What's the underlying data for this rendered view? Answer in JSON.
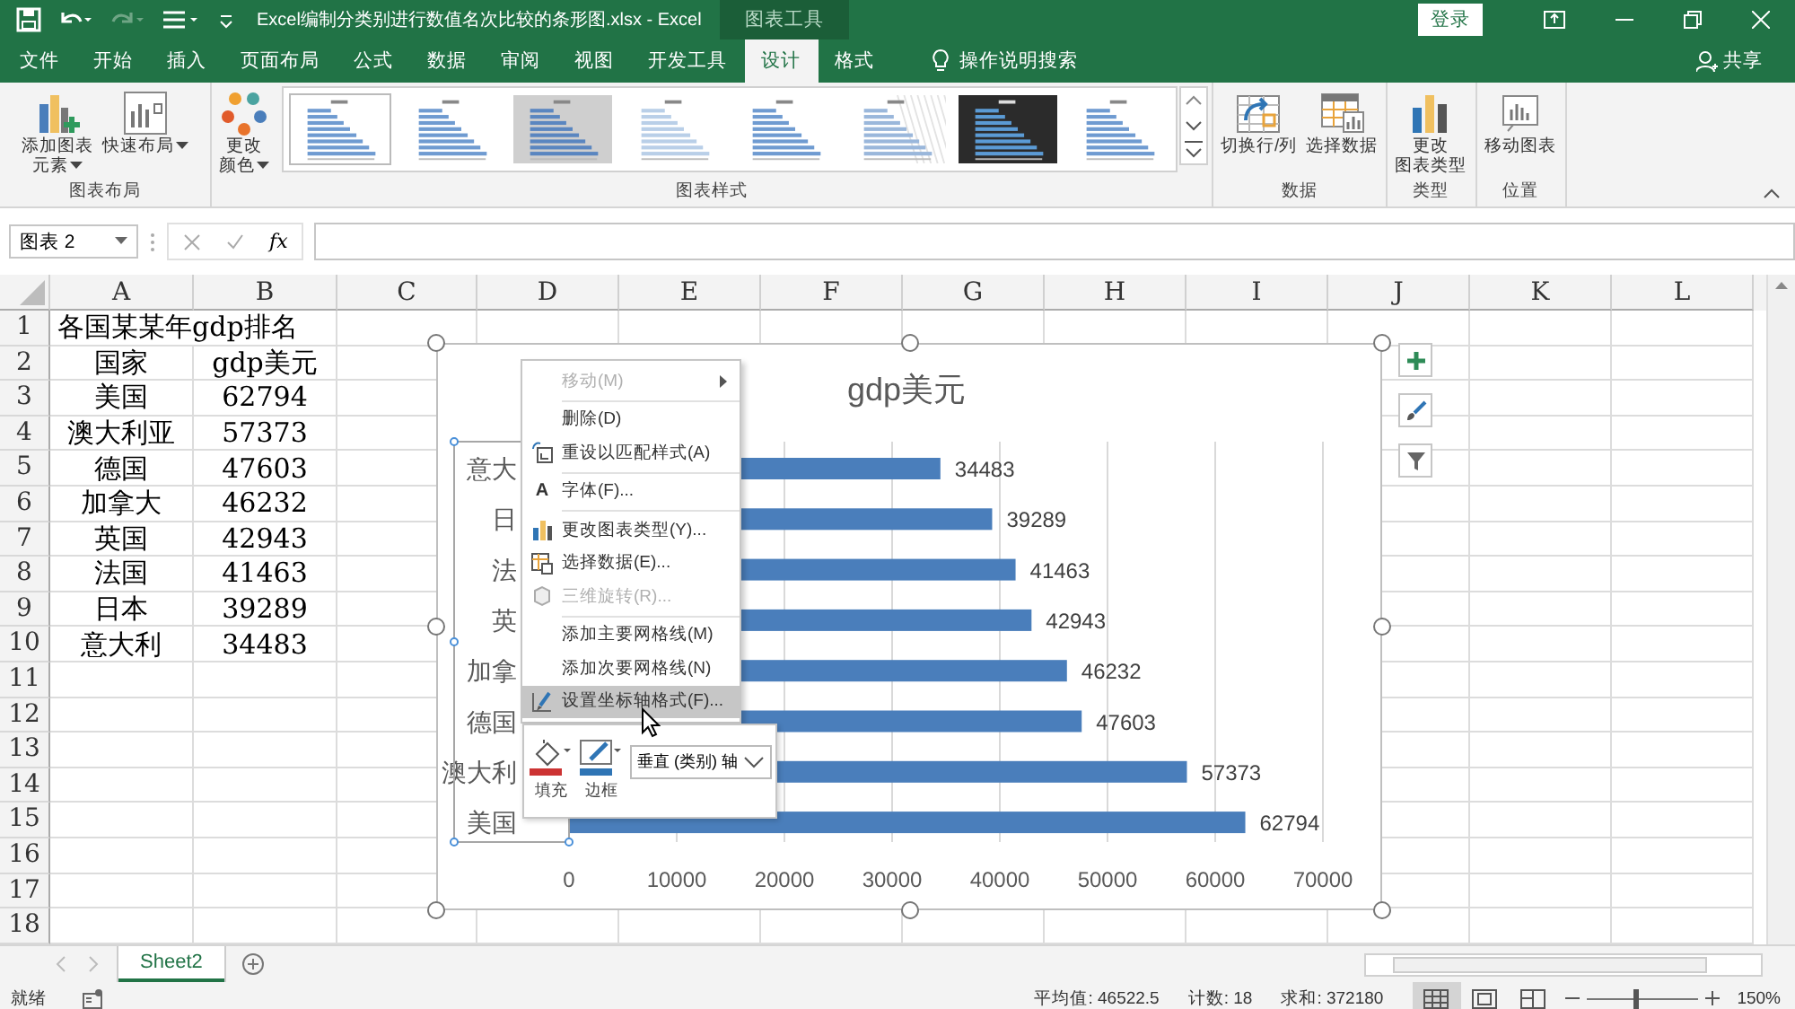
{
  "title_bar": {
    "title": "Excel编制分类别进行数值名次比较的条形图.xlsx  -  Excel",
    "context_header": "图表工具",
    "sign_in": "登录"
  },
  "tabs": [
    {
      "label": "文件",
      "selected": false
    },
    {
      "label": "开始",
      "selected": false
    },
    {
      "label": "插入",
      "selected": false
    },
    {
      "label": "页面布局",
      "selected": false
    },
    {
      "label": "公式",
      "selected": false
    },
    {
      "label": "数据",
      "selected": false
    },
    {
      "label": "审阅",
      "selected": false
    },
    {
      "label": "视图",
      "selected": false
    },
    {
      "label": "开发工具",
      "selected": false
    },
    {
      "label": "设计",
      "selected": true
    },
    {
      "label": "格式",
      "selected": false
    }
  ],
  "tell_me": "操作说明搜索",
  "share": "共享",
  "ribbon": {
    "chart_layout": {
      "label": "图表布局",
      "buttons": [
        {
          "kind": "add-element",
          "lines": [
            "添加图表",
            "元素"
          ],
          "dropdown": true
        },
        {
          "kind": "quick-layout",
          "lines": [
            "快速布局"
          ],
          "dropdown": true
        }
      ]
    },
    "chart_styles": {
      "label": "图表样式",
      "color_button": {
        "kind": "colors",
        "lines": [
          "更改",
          "颜色"
        ],
        "dropdown": true
      },
      "styles": [
        {
          "kind": "light",
          "selected": true
        },
        {
          "kind": "light",
          "selected": false
        },
        {
          "kind": "gray",
          "selected": false
        },
        {
          "kind": "pale",
          "selected": false
        },
        {
          "kind": "light",
          "selected": false
        },
        {
          "kind": "hatched",
          "selected": false
        },
        {
          "kind": "dark",
          "selected": false
        },
        {
          "kind": "light",
          "selected": false
        }
      ]
    },
    "data": {
      "label": "数据",
      "buttons": [
        {
          "kind": "switch",
          "lines": [
            "切换行/列"
          ]
        },
        {
          "kind": "select-data",
          "lines": [
            "选择数据"
          ]
        }
      ]
    },
    "type": {
      "label": "类型",
      "buttons": [
        {
          "kind": "change-type",
          "lines": [
            "更改",
            "图表类型"
          ]
        }
      ]
    },
    "location": {
      "label": "位置",
      "buttons": [
        {
          "kind": "move",
          "lines": [
            "移动图表"
          ]
        }
      ]
    }
  },
  "formula_bar": {
    "name_box": "图表 2",
    "function_label": "fx"
  },
  "sheet": {
    "columns": [
      "A",
      "B",
      "C",
      "D",
      "E",
      "F",
      "G",
      "H",
      "I",
      "J",
      "K",
      "L"
    ],
    "rows": [
      {
        "number": "1",
        "cells": [
          "各国某某年gdp排名"
        ]
      },
      {
        "number": "2",
        "cells": [
          "国家",
          "gdp美元"
        ]
      },
      {
        "number": "3",
        "cells": [
          "美国",
          "62794"
        ]
      },
      {
        "number": "4",
        "cells": [
          "澳大利亚",
          "57373"
        ]
      },
      {
        "number": "5",
        "cells": [
          "德国",
          "47603"
        ]
      },
      {
        "number": "6",
        "cells": [
          "加拿大",
          "46232"
        ]
      },
      {
        "number": "7",
        "cells": [
          "英国",
          "42943"
        ]
      },
      {
        "number": "8",
        "cells": [
          "法国",
          "41463"
        ]
      },
      {
        "number": "9",
        "cells": [
          "日本",
          "39289"
        ]
      },
      {
        "number": "10",
        "cells": [
          "意大利",
          "34483"
        ]
      },
      {
        "number": "11"
      },
      {
        "number": "12"
      },
      {
        "number": "13"
      },
      {
        "number": "14"
      },
      {
        "number": "15"
      },
      {
        "number": "16"
      },
      {
        "number": "17"
      },
      {
        "number": "18"
      }
    ]
  },
  "chart": {
    "title": "gdp美元",
    "axis_selected": true,
    "chart_data": {
      "type": "bar",
      "orientation": "horizontal",
      "categories": [
        "意大",
        "日",
        "法",
        "英",
        "加拿",
        "德国",
        "澳大利",
        "美国"
      ],
      "series": [
        {
          "color": "#4a7ebb",
          "values": [
            34483,
            39289,
            41463,
            42943,
            46232,
            47603,
            57373,
            62794
          ]
        }
      ],
      "xlim": [
        0,
        70000
      ],
      "xticks": [
        0,
        10000,
        20000,
        30000,
        40000,
        50000,
        60000,
        70000
      ],
      "data_labels": true,
      "grid": true
    }
  },
  "context_menu": {
    "groups": [
      {
        "items": [
          {
            "label": "移动(M)",
            "disabled": true,
            "selected": false,
            "submenu": true
          }
        ]
      },
      {
        "items": [
          {
            "label": "删除(D)",
            "disabled": false,
            "selected": false
          },
          {
            "label": "重设以匹配样式(A)",
            "disabled": false,
            "selected": false,
            "kind": "reset"
          }
        ]
      },
      {
        "items": [
          {
            "label": "字体(F)...",
            "disabled": false,
            "selected": false,
            "icon_text": "A"
          }
        ]
      },
      {
        "items": [
          {
            "label": "更改图表类型(Y)...",
            "disabled": false,
            "selected": false,
            "kind": "chart"
          },
          {
            "label": "选择数据(E)...",
            "disabled": false,
            "selected": false,
            "kind": "data"
          },
          {
            "label": "三维旋转(R)...",
            "disabled": true,
            "selected": false,
            "kind": "rotate"
          }
        ]
      },
      {
        "items": [
          {
            "label": "添加主要网格线(M)",
            "disabled": false,
            "selected": false
          },
          {
            "label": "添加次要网格线(N)",
            "disabled": false,
            "selected": false
          },
          {
            "label": "设置坐标轴格式(F)...",
            "disabled": false,
            "selected": true,
            "kind": "format"
          }
        ]
      }
    ]
  },
  "mini_toolbar": {
    "fill": "填充",
    "border": "边框",
    "element": "垂直 (类别) 轴"
  },
  "sheet_tabs": [
    {
      "label": "Sheet2",
      "selected": true
    }
  ],
  "status_bar": {
    "ready": "就绪",
    "average": "平均值: 46522.5",
    "count": "计数: 18",
    "sum": "求和: 372180",
    "views": [
      {
        "kind": "normal",
        "selected": true
      },
      {
        "kind": "page-layout",
        "selected": false
      },
      {
        "kind": "page-break",
        "selected": false
      }
    ],
    "zoom": {
      "level": 0.45,
      "label": "150%"
    }
  }
}
